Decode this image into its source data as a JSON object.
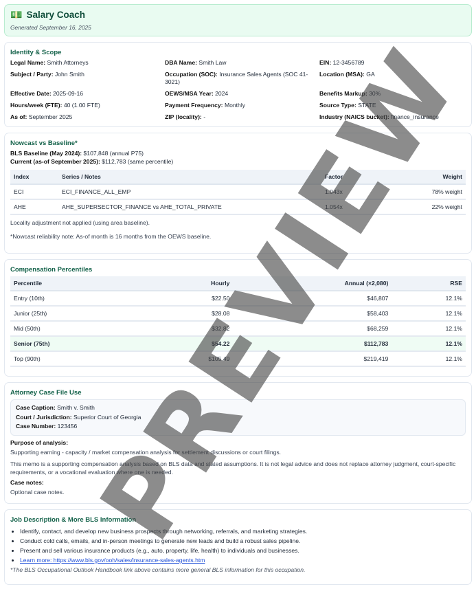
{
  "header": {
    "title": "Salary Coach",
    "generated": "Generated September 16, 2025",
    "logo_icon": "money-hands-icon"
  },
  "identity": {
    "title": "Identity & Scope",
    "fields": [
      {
        "label": "Legal Name:",
        "value": "Smith Attorneys"
      },
      {
        "label": "DBA Name:",
        "value": "Smith Law"
      },
      {
        "label": "EIN:",
        "value": "12-3456789"
      },
      {
        "label": "Subject / Party:",
        "value": "John Smith"
      },
      {
        "label": "Occupation (SOC):",
        "value": "Insurance Sales Agents (SOC 41-3021)"
      },
      {
        "label": "Location (MSA):",
        "value": "GA"
      },
      {
        "label": "Effective Date:",
        "value": "2025-09-16"
      },
      {
        "label": "OEWS/MSA Year:",
        "value": "2024"
      },
      {
        "label": "Benefits Markup:",
        "value": "30%"
      },
      {
        "label": "Hours/week (FTE):",
        "value": "40 (1.00 FTE)"
      },
      {
        "label": "Payment Frequency:",
        "value": "Monthly"
      },
      {
        "label": "Source Type:",
        "value": "STATE"
      },
      {
        "label": "As of:",
        "value": "September 2025"
      },
      {
        "label": "ZIP (locality):",
        "value": "-"
      },
      {
        "label": "Industry (NAICS bucket):",
        "value": "finance_insurance"
      }
    ]
  },
  "nowcast": {
    "title": "Nowcast vs Baseline*",
    "baseline_label": "BLS Baseline (May 2024):",
    "baseline_value": "$107,848 (annual P75)",
    "current_label": "Current (as-of September 2025):",
    "current_value": "$112,783 (same percentile)",
    "columns": [
      "Index",
      "Series / Notes",
      "Factor",
      "Weight"
    ],
    "rows": [
      [
        "ECI",
        "ECI_FINANCE_ALL_EMP",
        "1.043x",
        "78% weight"
      ],
      [
        "AHE",
        "AHE_SUPERSECTOR_FINANCE vs AHE_TOTAL_PRIVATE",
        "1.054x",
        "22% weight"
      ]
    ],
    "locality_note": "Locality adjustment not applied (using area baseline).",
    "reliability_note": "*Nowcast reliability note: As-of month is 16 months from the OEWS baseline."
  },
  "percentiles": {
    "title": "Compensation Percentiles",
    "columns": [
      "Percentile",
      "Hourly",
      "Annual (×2,080)",
      "RSE"
    ],
    "rows": [
      [
        "Entry (10th)",
        "$22.50",
        "$46,807",
        "12.1%"
      ],
      [
        "Junior (25th)",
        "$28.08",
        "$58,403",
        "12.1%"
      ],
      [
        "Mid (50th)",
        "$32.82",
        "$68,259",
        "12.1%"
      ],
      [
        "Senior (75th)",
        "$54.22",
        "$112,783",
        "12.1%"
      ],
      [
        "Top (90th)",
        "$105.49",
        "$219,419",
        "12.1%"
      ]
    ]
  },
  "attorney": {
    "title": "Attorney Case File Use",
    "caption_label": "Case Caption:",
    "caption": "Smith v. Smith",
    "court_label": "Court / Jurisdiction:",
    "court": "Superior Court of Georgia",
    "number_label": "Case Number:",
    "number": "123456",
    "purpose_label": "Purpose of analysis:",
    "purpose": "Supporting earning - capacity / market compensation analysis for settlement discussions or court filings.",
    "disclaimer": "This memo is a supporting compensation analysis based on BLS data and stated assumptions. It is not legal advice and does not replace attorney judgment, court-specific requirements, or a vocational evaluation where one is needed.",
    "notes_label": "Case notes:",
    "notes": "Optional case notes."
  },
  "job": {
    "title": "Job Description & More BLS Information",
    "bullets": [
      "Identify, contact, and develop new business prospects through networking, referrals, and marketing strategies.",
      "Conduct cold calls, emails, and in-person meetings to generate new leads and build a robust sales pipeline.",
      "Present and sell various insurance products (e.g., auto, property, life, health) to individuals and businesses."
    ],
    "link": "Learn more: https://www.bls.gov/ooh/sales/insurance-sales-agents.htm",
    "footnote": "*The BLS Occupational Outlook Handbook link above contains more general BLS information for this occupation."
  },
  "watermark": "PREVIEW"
}
